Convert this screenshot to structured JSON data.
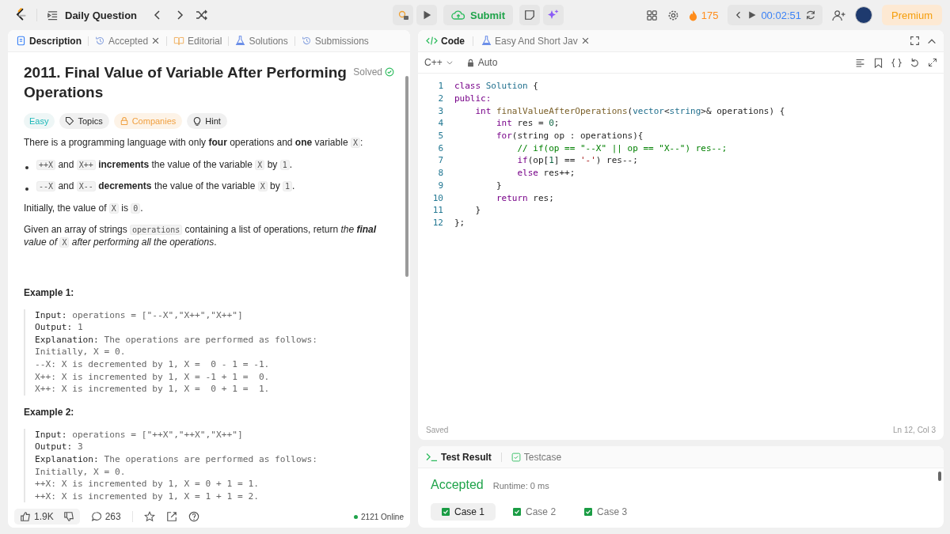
{
  "nav": {
    "title": "Daily Question",
    "submit": "Submit",
    "streak": "175",
    "timer": "00:02:51",
    "premium": "Premium"
  },
  "left_tabs": [
    {
      "label": "Description",
      "selected": true,
      "kind": "doc"
    },
    {
      "label": "Accepted",
      "selected": false,
      "kind": "history",
      "closable": true
    },
    {
      "label": "Editorial",
      "selected": false,
      "kind": "book"
    },
    {
      "label": "Solutions",
      "selected": false,
      "kind": "flask"
    },
    {
      "label": "Submissions",
      "selected": false,
      "kind": "history"
    }
  ],
  "problem": {
    "title": "2011. Final Value of Variable After Performing Operations",
    "status": "Solved",
    "tags": [
      {
        "label": "Easy",
        "kind": "difficulty"
      },
      {
        "label": "Topics",
        "kind": "tag"
      },
      {
        "label": "Companies",
        "kind": "lock"
      },
      {
        "label": "Hint",
        "kind": "bulb"
      }
    ],
    "paragraphs": [
      {
        "kind": "text",
        "segments": [
          {
            "kind": "text",
            "text": "There is a programming language with only **four** operations and **one** variable "
          },
          {
            "kind": "code",
            "text": "X"
          },
          {
            "kind": "text",
            "text": ":"
          }
        ]
      },
      {
        "kind": "bullet",
        "segments": [
          {
            "kind": "code",
            "text": "++X"
          },
          {
            "kind": "text",
            "text": " and "
          },
          {
            "kind": "code",
            "text": "X++"
          },
          {
            "kind": "text",
            "text": " **increments** the value of the variable "
          },
          {
            "kind": "code",
            "text": "X"
          },
          {
            "kind": "text",
            "text": " by "
          },
          {
            "kind": "code",
            "text": "1"
          },
          {
            "kind": "text",
            "text": "."
          }
        ]
      },
      {
        "kind": "bullet",
        "segments": [
          {
            "kind": "code",
            "text": "--X"
          },
          {
            "kind": "text",
            "text": " and "
          },
          {
            "kind": "code",
            "text": "X--"
          },
          {
            "kind": "text",
            "text": " **decrements** the value of the variable "
          },
          {
            "kind": "code",
            "text": "X"
          },
          {
            "kind": "text",
            "text": " by "
          },
          {
            "kind": "code",
            "text": "1"
          },
          {
            "kind": "text",
            "text": "."
          }
        ]
      },
      {
        "kind": "text",
        "segments": [
          {
            "kind": "text",
            "text": "Initially, the value of "
          },
          {
            "kind": "code",
            "text": "X"
          },
          {
            "kind": "text",
            "text": " is "
          },
          {
            "kind": "code",
            "text": "0"
          },
          {
            "kind": "text",
            "text": "."
          }
        ]
      },
      {
        "kind": "text",
        "segments": [
          {
            "kind": "text",
            "text": "Given an array of strings "
          },
          {
            "kind": "code",
            "text": "operations"
          },
          {
            "kind": "text",
            "text": " containing a list of operations, return "
          },
          {
            "kind": "em",
            "text": "the **final** value of "
          },
          {
            "kind": "code",
            "text": "X"
          },
          {
            "kind": "em",
            "text": " after performing all the operations"
          },
          {
            "kind": "text",
            "text": "."
          }
        ]
      }
    ],
    "examples": [
      {
        "title": "Example 1:",
        "lines": [
          {
            "label": "Input:",
            "text": " operations = [\"--X\",\"X++\",\"X++\"]"
          },
          {
            "label": "Output:",
            "text": " 1"
          },
          {
            "label": "Explanation:",
            "text": " The operations are performed as follows:"
          },
          {
            "text": "Initially, X = 0."
          },
          {
            "text": "--X: X is decremented by 1, X =  0 - 1 = -1."
          },
          {
            "text": "X++: X is incremented by 1, X = -1 + 1 =  0."
          },
          {
            "text": "X++: X is incremented by 1, X =  0 + 1 =  1."
          }
        ]
      },
      {
        "title": "Example 2:",
        "lines": [
          {
            "label": "Input:",
            "text": " operations = [\"++X\",\"++X\",\"X++\"]"
          },
          {
            "label": "Output:",
            "text": " 3"
          },
          {
            "label": "Explanation:",
            "text": " The operations are performed as follows:"
          },
          {
            "text": "Initially, X = 0."
          },
          {
            "text": "++X: X is incremented by 1, X = 0 + 1 = 1."
          },
          {
            "text": "++X: X is incremented by 1, X = 1 + 1 = 2."
          }
        ]
      }
    ]
  },
  "footer": {
    "likes": "1.9K",
    "comments": "263",
    "online": "2121 Online"
  },
  "code_tabs": [
    {
      "label": "Code",
      "selected": true,
      "kind": "code"
    },
    {
      "label": "Easy And Short Jav",
      "selected": false,
      "kind": "flask",
      "closable": true
    }
  ],
  "editor": {
    "language": "C++",
    "mode": "Auto",
    "lines": [
      {
        "number": "1",
        "tokens": [
          {
            "kind": "kw",
            "text": "class"
          },
          {
            "kind": "type",
            "text": " Solution"
          },
          {
            "kind": "plain",
            "text": " {"
          }
        ]
      },
      {
        "number": "2",
        "tokens": [
          {
            "kind": "kw",
            "text": "public:"
          }
        ]
      },
      {
        "number": "3",
        "tokens": [
          {
            "kind": "kw",
            "text": "    int"
          },
          {
            "kind": "fn",
            "text": " finalValueAfterOperations"
          },
          {
            "kind": "plain",
            "text": "("
          },
          {
            "kind": "type",
            "text": "vector"
          },
          {
            "kind": "plain",
            "text": "<"
          },
          {
            "kind": "type",
            "text": "string"
          },
          {
            "kind": "plain",
            "text": ">& operations) {"
          }
        ]
      },
      {
        "number": "4",
        "tokens": [
          {
            "kind": "kw",
            "text": "        int"
          },
          {
            "kind": "plain",
            "text": " res = "
          },
          {
            "kind": "num",
            "text": "0"
          },
          {
            "kind": "plain",
            "text": ";"
          }
        ]
      },
      {
        "number": "5",
        "tokens": [
          {
            "kind": "kw",
            "text": "        for"
          },
          {
            "kind": "plain",
            "text": "(string op : operations){"
          }
        ]
      },
      {
        "number": "6",
        "tokens": [
          {
            "kind": "cmt",
            "text": "            // if(op == \"--X\" || op == \"X--\") res--;"
          }
        ]
      },
      {
        "number": "7",
        "tokens": [
          {
            "kind": "kw",
            "text": "            if"
          },
          {
            "kind": "plain",
            "text": "(op["
          },
          {
            "kind": "num",
            "text": "1"
          },
          {
            "kind": "plain",
            "text": "] == "
          },
          {
            "kind": "str",
            "text": "'-'"
          },
          {
            "kind": "plain",
            "text": ") res--;"
          }
        ]
      },
      {
        "number": "8",
        "tokens": [
          {
            "kind": "kw",
            "text": "            else"
          },
          {
            "kind": "plain",
            "text": " res++;"
          }
        ]
      },
      {
        "number": "9",
        "tokens": [
          {
            "kind": "plain",
            "text": "        }"
          }
        ]
      },
      {
        "number": "10",
        "tokens": [
          {
            "kind": "kw",
            "text": "        return"
          },
          {
            "kind": "plain",
            "text": " res;"
          }
        ]
      },
      {
        "number": "11",
        "tokens": [
          {
            "kind": "plain",
            "text": "    }"
          }
        ]
      },
      {
        "number": "12",
        "tokens": [
          {
            "kind": "plain",
            "text": "};"
          }
        ]
      }
    ],
    "saved": "Saved",
    "cursor": "Ln 12, Col 3"
  },
  "result_tabs": [
    {
      "label": "Test Result",
      "selected": true,
      "kind": "terminal"
    },
    {
      "label": "Testcase",
      "selected": false,
      "kind": "check"
    }
  ],
  "result": {
    "verdict": "Accepted",
    "runtime": "Runtime: 0 ms",
    "cases": [
      {
        "label": "Case 1",
        "selected": true
      },
      {
        "label": "Case 2",
        "selected": false
      },
      {
        "label": "Case 3",
        "selected": false
      }
    ]
  }
}
